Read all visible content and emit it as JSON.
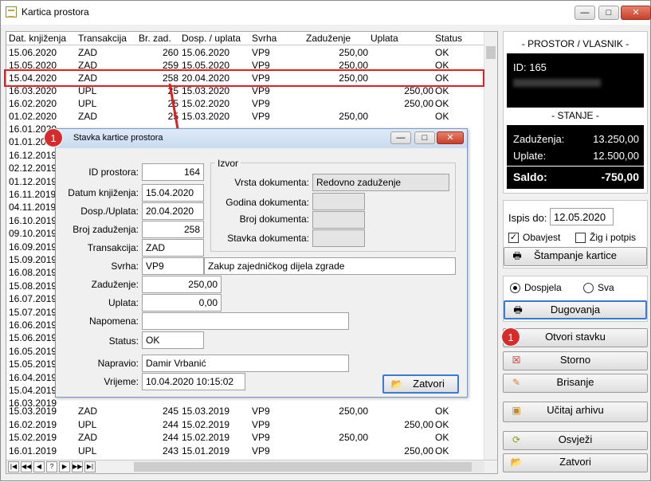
{
  "window": {
    "title": "Kartica prostora"
  },
  "grid": {
    "columns": [
      "Dat. knjiženja",
      "Transakcija",
      "Br. zad.",
      "Dosp. / uplata",
      "Svrha",
      "Zaduženje",
      "Uplata",
      "Status"
    ],
    "rows_top": [
      [
        "15.06.2020",
        "ZAD",
        "260",
        "15.06.2020",
        "VP9",
        "250,00",
        "",
        "OK"
      ],
      [
        "15.05.2020",
        "ZAD",
        "259",
        "15.05.2020",
        "VP9",
        "250,00",
        "",
        "OK"
      ],
      [
        "15.04.2020",
        "ZAD",
        "258",
        "20.04.2020",
        "VP9",
        "250,00",
        "",
        "OK"
      ],
      [
        "16.03.2020",
        "UPL",
        "25",
        "15.03.2020",
        "VP9",
        "",
        "250,00",
        "OK"
      ],
      [
        "16.02.2020",
        "UPL",
        "25",
        "15.02.2020",
        "VP9",
        "",
        "250,00",
        "OK"
      ],
      [
        "01.02.2020",
        "ZAD",
        "25",
        "15.03.2020",
        "VP9",
        "250,00",
        "",
        "OK"
      ]
    ],
    "left_dates": [
      "16.01.2020",
      "01.01.2020",
      "16.12.2019",
      "02.12.2019",
      "01.12.2019",
      "16.11.2019",
      "04.11.2019",
      "16.10.2019",
      "09.10.2019",
      "16.09.2019",
      "15.09.2019",
      "16.08.2019",
      "15.08.2019",
      "16.07.2019",
      "15.07.2019",
      "16.06.2019",
      "15.06.2019",
      "16.05.2019",
      "15.05.2019",
      "16.04.2019",
      "15.04.2019",
      "16.03.2019"
    ],
    "rows_bottom": [
      [
        "15.03.2019",
        "ZAD",
        "245",
        "15.03.2019",
        "VP9",
        "250,00",
        "",
        "OK"
      ],
      [
        "16.02.2019",
        "UPL",
        "244",
        "15.02.2019",
        "VP9",
        "",
        "250,00",
        "OK"
      ],
      [
        "15.02.2019",
        "ZAD",
        "244",
        "15.02.2019",
        "VP9",
        "250,00",
        "",
        "OK"
      ],
      [
        "16.01.2019",
        "UPL",
        "243",
        "15.01.2019",
        "VP9",
        "",
        "250,00",
        "OK"
      ]
    ]
  },
  "dialog": {
    "title": "Stavka kartice prostora",
    "labels": {
      "id": "ID prostora:",
      "datum": "Datum knjiženja:",
      "dosp": "Dosp./Uplata:",
      "broj": "Broj zaduženja:",
      "trans": "Transakcija:",
      "svrha": "Svrha:",
      "zad": "Zaduženje:",
      "upl": "Uplata:",
      "napomena": "Napomena:",
      "status": "Status:",
      "napravio": "Napravio:",
      "vrijeme": "Vrijeme:"
    },
    "values": {
      "id": "164",
      "datum": "15.04.2020",
      "dosp": "20.04.2020",
      "broj": "258",
      "trans": "ZAD",
      "svrha": "VP9",
      "svrha_opis": "Zakup zajedničkog dijela zgrade",
      "zad": "250,00",
      "upl": "0,00",
      "napomena": "",
      "status": "OK",
      "napravio": "Damir Vrbanić",
      "vrijeme": "10.04.2020 10:15:02"
    },
    "izvor": {
      "title": "Izvor",
      "vrsta_label": "Vrsta dokumenta:",
      "vrsta_value": "Redovno zaduženje",
      "godina_label": "Godina dokumenta:",
      "broj_label": "Broj dokumenta:",
      "stavka_label": "Stavka dokumenta:"
    },
    "close_label": "Zatvori"
  },
  "panel": {
    "header": "- PROSTOR / VLASNIK -",
    "id_text": "ID: 165",
    "stanje": "- STANJE -",
    "zaduzenja_label": "Zaduženja:",
    "zaduzenja_value": "13.250,00",
    "uplate_label": "Uplate:",
    "uplate_value": "12.500,00",
    "saldo_label": "Saldo:",
    "saldo_value": "-750,00",
    "ispis_label": "Ispis do:",
    "ispis_value": "12.05.2020",
    "obavjest": "Obavjest",
    "zig": "Žig i potpis",
    "stampanje": "Štampanje kartice",
    "dospjela": "Dospjela",
    "sva": "Sva",
    "dugovanja": "Dugovanja",
    "otvori": "Otvori stavku",
    "storno": "Storno",
    "brisanje": "Brisanje",
    "ucitaj": "Učitaj arhivu",
    "osvjezi": "Osvježi",
    "zatvori": "Zatvori"
  },
  "badges": {
    "one": "1"
  },
  "colors": {
    "highlight": "#e02020",
    "badge": "#d42c2c",
    "panel_black": "#000000"
  }
}
